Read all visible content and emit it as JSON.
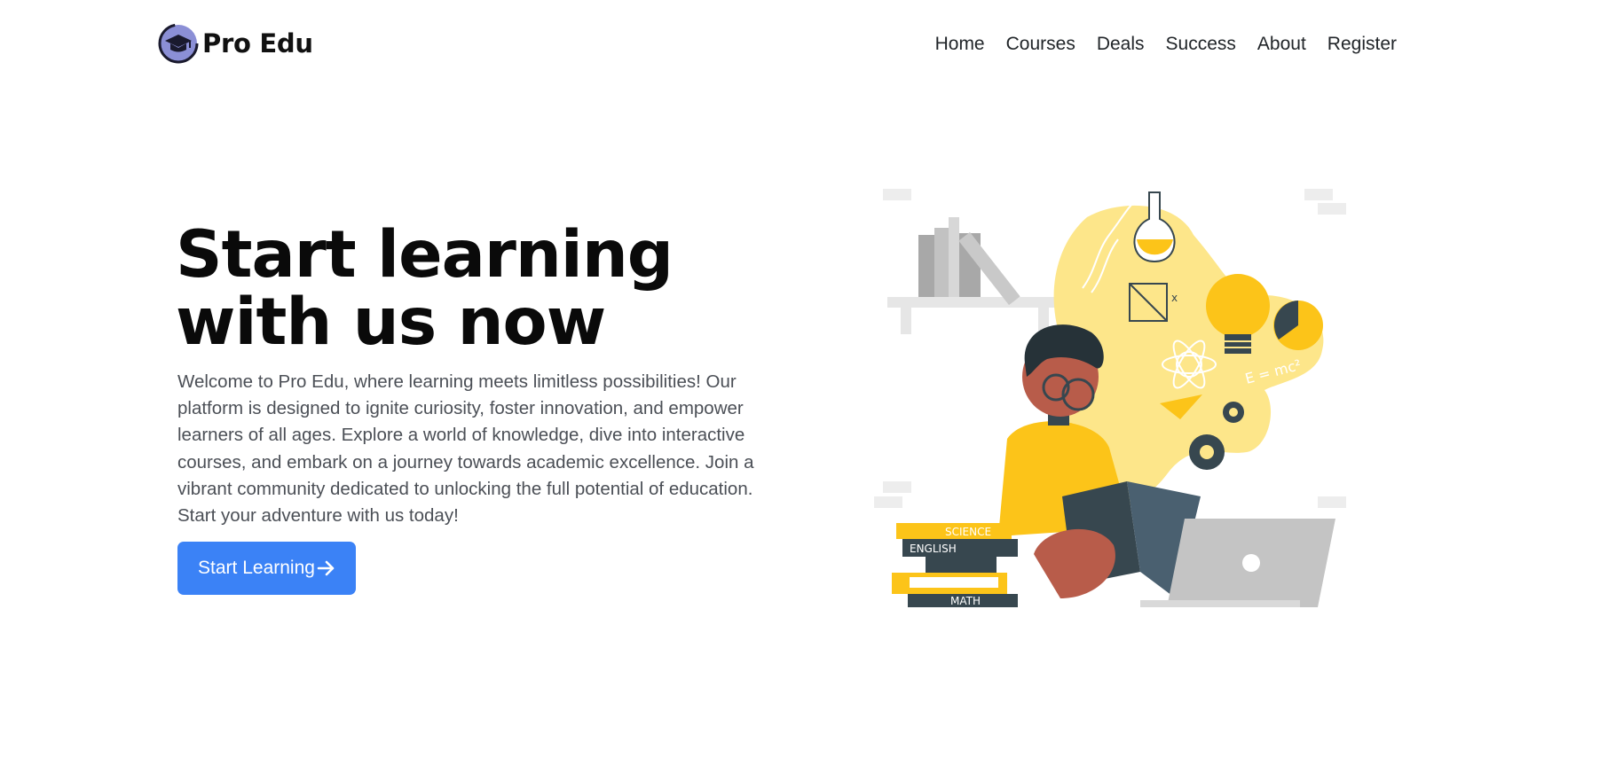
{
  "brand": {
    "name": "Pro Edu",
    "logo_icon": "graduation-cap-icon",
    "accent_color": "#8b8fd6"
  },
  "nav": {
    "items": [
      {
        "label": "Home"
      },
      {
        "label": "Courses"
      },
      {
        "label": "Deals"
      },
      {
        "label": "Success"
      },
      {
        "label": "About"
      },
      {
        "label": "Register"
      }
    ]
  },
  "hero": {
    "title_line1": "Start learning",
    "title_line2": "with us now",
    "description": "Welcome to Pro Edu, where learning meets limitless possibilities! Our platform is designed to ignite curiosity, foster innovation, and empower learners of all ages. Explore a world of knowledge, dive into interactive courses, and embark on a journey towards academic excellence. Join a vibrant community dedicated to unlocking the full potential of education. Start your adventure with us today!",
    "cta_label": "Start Learning",
    "cta_icon": "arrow-right-icon",
    "cta_color": "#3b82f6"
  },
  "illustration": {
    "name": "student-reading-illustration",
    "book_labels": [
      "SCIENCE",
      "ENGLISH",
      "MATH"
    ],
    "formula": "E = mc²",
    "colors": {
      "yellow": "#fcc419",
      "light_yellow": "#fde68a",
      "dark_teal": "#37474f",
      "skin": "#b85c4a",
      "gray": "#bdbdbd"
    }
  }
}
